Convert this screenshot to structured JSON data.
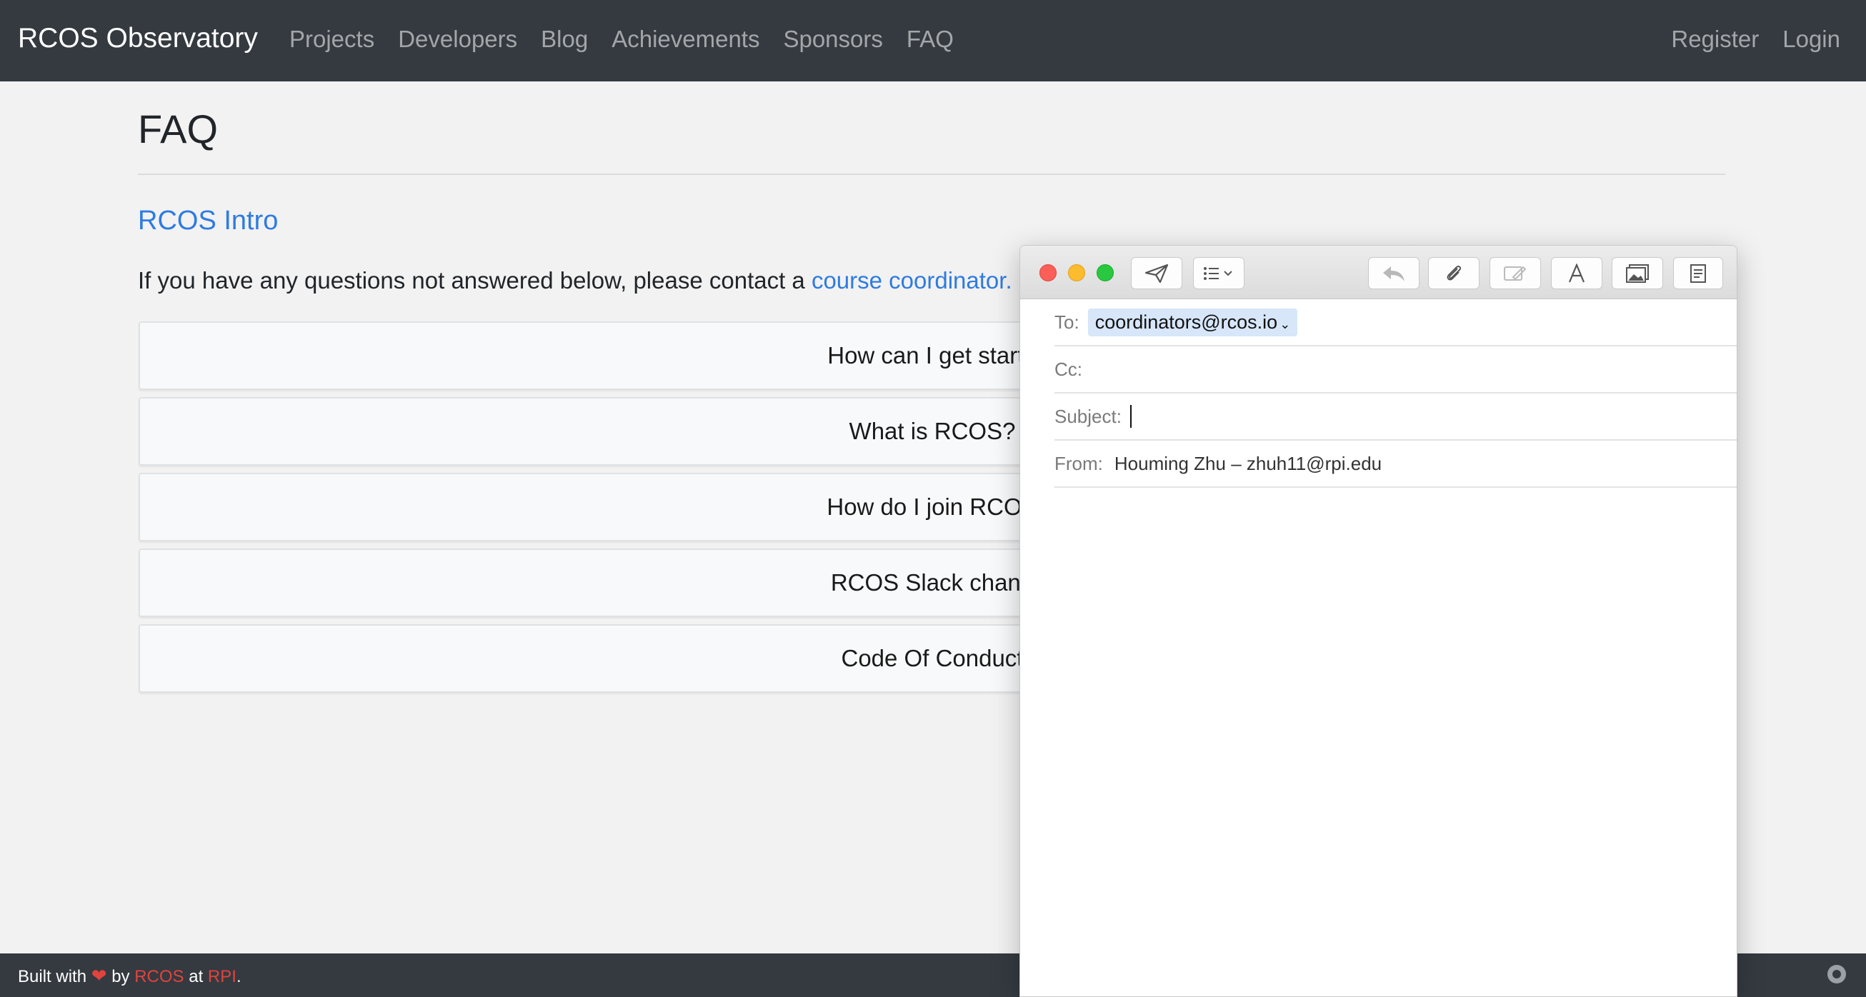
{
  "navbar": {
    "brand": "RCOS Observatory",
    "links": [
      "Projects",
      "Developers",
      "Blog",
      "Achievements",
      "Sponsors",
      "FAQ"
    ],
    "right_links": [
      "Register",
      "Login"
    ]
  },
  "main": {
    "title": "FAQ",
    "section_title": "RCOS Intro",
    "intro_text": "If you have any questions not answered below, please contact a ",
    "intro_link": "course coordinator.",
    "faq_items": [
      "How can I get starte",
      "What is RCOS?",
      "How do I join RCOS",
      "RCOS Slack chann",
      "Code Of Conduct"
    ]
  },
  "footer": {
    "built_with": "Built with",
    "by": "by",
    "rcos": "RCOS",
    "at": "at",
    "rpi": "RPI",
    "period": ".",
    "icons": [
      "heart-icon",
      "github-icon"
    ],
    "colors": {
      "accent": "#e0433d",
      "bar": "#343a40"
    }
  },
  "mail": {
    "to_label": "To:",
    "to_value": "coordinators@rcos.io",
    "cc_label": "Cc:",
    "subject_label": "Subject:",
    "from_label": "From:",
    "from_value": "Houming Zhu – zhuh11@rpi.edu",
    "icons": [
      "send-icon",
      "list-icon",
      "reply-icon",
      "attachment-icon",
      "markup-icon",
      "font-icon",
      "photo-icon",
      "template-icon"
    ]
  },
  "colors": {
    "link": "#2f7be0",
    "navbar": "#343a40",
    "close": "#fc5f57",
    "minimize": "#fdbc2e",
    "zoom": "#29c840"
  }
}
